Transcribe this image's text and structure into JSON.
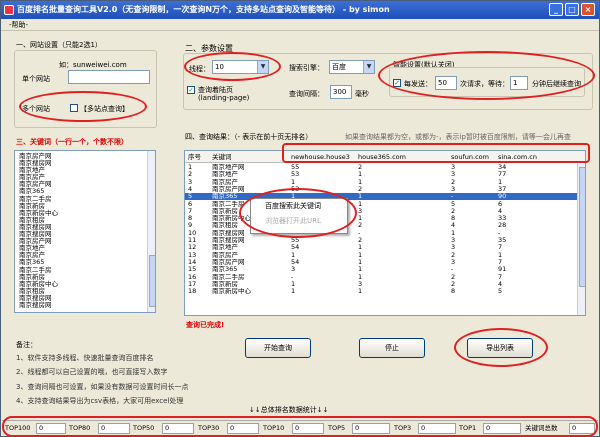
{
  "window": {
    "title": "百度排名批量查询工具V2.0（无查询限制，一次查询N万个，支持多站点查询及智能等待） - by simon"
  },
  "menu": {
    "help": "-帮助-"
  },
  "site": {
    "section_title": "一、网站设置（只能2选1）",
    "hint": "如：sunweiwei.com",
    "single_label": "单个网站",
    "single_value": "",
    "multi_label": "多个网站",
    "multi_query_label": "【多站点查询】"
  },
  "keywords": {
    "title": "三、关键词（一行一个，个数不限）",
    "items": [
      "南京房产网",
      "南京搜房网",
      "南京地产",
      "南京房产",
      "南京房产网",
      "南京365",
      "南京二手房",
      "南京新房",
      "南京新房中心",
      "南京租房",
      "南京搜房网",
      "南京搜房网",
      "南京房产网",
      "南京地产",
      "南京房产",
      "南京365",
      "南京二手房",
      "南京新房",
      "南京新房中心",
      "南京租房",
      "南京搜房网",
      "南京搜房网"
    ]
  },
  "params": {
    "section_title": "二、参数设置",
    "threads_label": "线程：",
    "threads_value": "10",
    "engine_label": "搜索引擎：",
    "engine_value": "百度",
    "landing_label": "查询着陆页",
    "landing_sub": "(landing-page)",
    "interval_label": "查询间隔：",
    "interval_value": "300",
    "interval_unit": "毫秒",
    "smart_title": "智能设置(默认关闭)",
    "every_label": "每发送：",
    "every_value": "50",
    "times_label": "次请求，等待：",
    "wait_value": "1",
    "wait_unit": "分钟后继续查询"
  },
  "results": {
    "title": "四、查询结果：（- 表示在前十页无排名）",
    "note": "如果查询结果都为空，或都为-，表示ip暂时被百度限制，请等一会儿再查",
    "columns": [
      "序号",
      "关键词",
      "newhouse.house3",
      "house365.com",
      "soufun.com",
      "sina.com.cn"
    ],
    "rows": [
      [
        "1",
        "南京地产网",
        "55",
        "2",
        "3",
        "34"
      ],
      [
        "2",
        "南京地产",
        "53",
        "1",
        "3",
        "77"
      ],
      [
        "3",
        "南京房产",
        "1",
        "1",
        "2",
        "1"
      ],
      [
        "4",
        "南京房产网",
        "53",
        "2",
        "3",
        "37"
      ],
      [
        "5",
        "南京365",
        "1",
        "1",
        "-",
        "90"
      ],
      [
        "6",
        "南京二手房",
        "2",
        "1",
        "5",
        "6"
      ],
      [
        "7",
        "南京新房",
        "1",
        "3",
        "2",
        "4"
      ],
      [
        "8",
        "南京新房中心",
        "1",
        "1",
        "8",
        "33"
      ],
      [
        "9",
        "南京租房",
        "1",
        "2",
        "4",
        "28"
      ],
      [
        "10",
        "南京搜房网",
        "-",
        "-",
        "1",
        "-"
      ],
      [
        "11",
        "南京搜房网",
        "55",
        "2",
        "3",
        "35"
      ],
      [
        "12",
        "南京地产",
        "54",
        "1",
        "3",
        "7"
      ],
      [
        "13",
        "南京房产",
        "1",
        "1",
        "2",
        "1"
      ],
      [
        "14",
        "南京房产网",
        "54",
        "1",
        "3",
        "7"
      ],
      [
        "15",
        "南京365",
        "3",
        "1",
        "-",
        "91"
      ],
      [
        "16",
        "南京二手房",
        "-",
        "1",
        "2",
        "7"
      ],
      [
        "17",
        "南京新房",
        "1",
        "3",
        "2",
        "4"
      ],
      [
        "18",
        "南京新房中心",
        "1",
        "1",
        "8",
        "5"
      ]
    ],
    "selected_row": 4,
    "context_menu": [
      "百度搜索此关键词",
      "浏览器打开此URL"
    ],
    "done_text": "查询已完成!"
  },
  "buttons": {
    "start": "开始查询",
    "stop": "停止",
    "export": "导出列表"
  },
  "notes": {
    "title": "备注：",
    "lines": [
      "1、软件支持多线程、快速批量查询百度排名",
      "2、线程都可以自己设置的哦，也可直接写入数字",
      "3、查询间隔也可设置，如果没有数据可设置时间长一点",
      "4、支持查询结果导出为csv表格，大家可用excel处理"
    ]
  },
  "stats": {
    "title": "↓↓总体排名数据统计↓↓",
    "items": [
      {
        "label": "TOP100",
        "value": "0"
      },
      {
        "label": "TOP80",
        "value": "0"
      },
      {
        "label": "TOP50",
        "value": "0"
      },
      {
        "label": "TOP30",
        "value": "0"
      },
      {
        "label": "TOP10",
        "value": "0"
      },
      {
        "label": "TOP5",
        "value": "0"
      },
      {
        "label": "TOP3",
        "value": "0"
      },
      {
        "label": "TOP1",
        "value": "0"
      },
      {
        "label": "关键词总数",
        "value": "0"
      }
    ]
  },
  "colors": {
    "accent_red": "#e00000",
    "selection": "#316ac5",
    "title_blue": "#2454c0"
  }
}
